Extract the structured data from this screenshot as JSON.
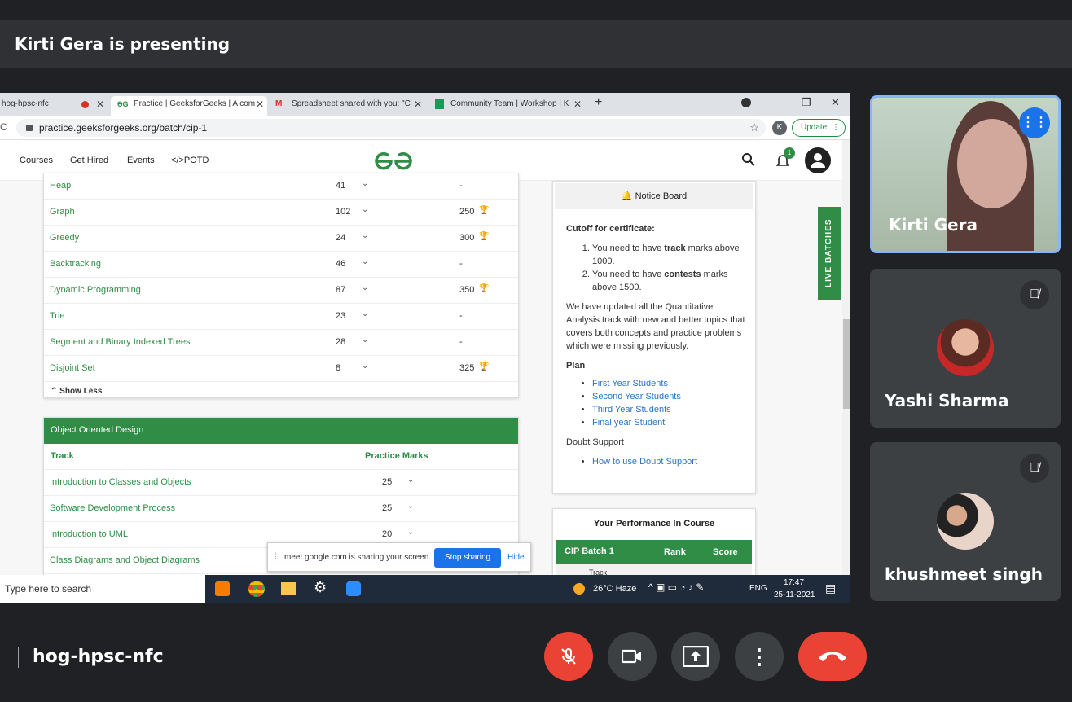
{
  "meet": {
    "presenting_text": "Kirti Gera is presenting",
    "meeting_name": "hog-hpsc-nfc",
    "participants": [
      {
        "name": "Kirti Gera"
      },
      {
        "name": "Yashi Sharma"
      },
      {
        "name": "khushmeet singh"
      }
    ]
  },
  "browser": {
    "tabs": [
      {
        "label": "hog-hpsc-nfc"
      },
      {
        "label": "Practice | GeeksforGeeks | A com"
      },
      {
        "label": "Spreadsheet shared with you: \"C"
      },
      {
        "label": "Community Team | Workshop | K"
      }
    ],
    "url": "practice.geeksforgeeks.org/batch/cip-1",
    "profile_letter": "K",
    "update_label": "Update"
  },
  "site": {
    "nav": [
      "Courses",
      "Get Hired",
      "Events",
      "</>POTD"
    ],
    "notification_count": "1",
    "track_rows": [
      {
        "name": "Heap",
        "count": "41",
        "marks": "-"
      },
      {
        "name": "Graph",
        "count": "102",
        "marks": "250"
      },
      {
        "name": "Greedy",
        "count": "24",
        "marks": "300"
      },
      {
        "name": "Backtracking",
        "count": "46",
        "marks": "-"
      },
      {
        "name": "Dynamic Programming",
        "count": "87",
        "marks": "350"
      },
      {
        "name": "Trie",
        "count": "23",
        "marks": "-"
      },
      {
        "name": "Segment and Binary Indexed Trees",
        "count": "28",
        "marks": "-"
      },
      {
        "name": "Disjoint Set",
        "count": "8",
        "marks": "325"
      }
    ],
    "show_less": "Show Less",
    "ood": {
      "title": "Object Oriented Design",
      "col_track": "Track",
      "col_marks": "Practice Marks",
      "rows": [
        {
          "name": "Introduction to Classes and Objects",
          "marks": "25"
        },
        {
          "name": "Software Development Process",
          "marks": "25"
        },
        {
          "name": "Introduction to UML",
          "marks": "20"
        },
        {
          "name": "Class Diagrams and Object Diagrams",
          "marks": ""
        }
      ]
    },
    "notice": {
      "title": "Notice Board",
      "cutoff_title": "Cutoff for certificate:",
      "items": [
        {
          "pre": "You need to have ",
          "bold": "track",
          "post": " marks above 1000."
        },
        {
          "pre": "You need to have ",
          "bold": "contests",
          "post": " marks above 1500."
        }
      ],
      "para": "We have updated all the Quantitative Analysis track with new and better topics that covers both concepts and practice problems which were missing previously.",
      "plan_title": "Plan",
      "plan_links": [
        "First Year Students",
        "Second Year Students",
        "Third Year Students",
        "Final year Student"
      ],
      "doubt_title": "Doubt Support",
      "doubt_link": "How to use Doubt Support"
    },
    "performance": {
      "title": "Your Performance In Course",
      "headers": [
        "CIP Batch 1",
        "Rank",
        "Score"
      ],
      "sub": "Track"
    },
    "live_batches": "LIVE BATCHES"
  },
  "share_bar": {
    "text": "meet.google.com is sharing your screen.",
    "stop": "Stop sharing",
    "hide": "Hide"
  },
  "taskbar": {
    "search": "Type here to search",
    "weather": "26°C  Haze",
    "lang": "ENG",
    "time": "17:47",
    "date": "25-11-2021"
  },
  "colors": {
    "brand": "#2f8d46",
    "end_call": "#ea4335",
    "accent": "#1a73e8"
  }
}
